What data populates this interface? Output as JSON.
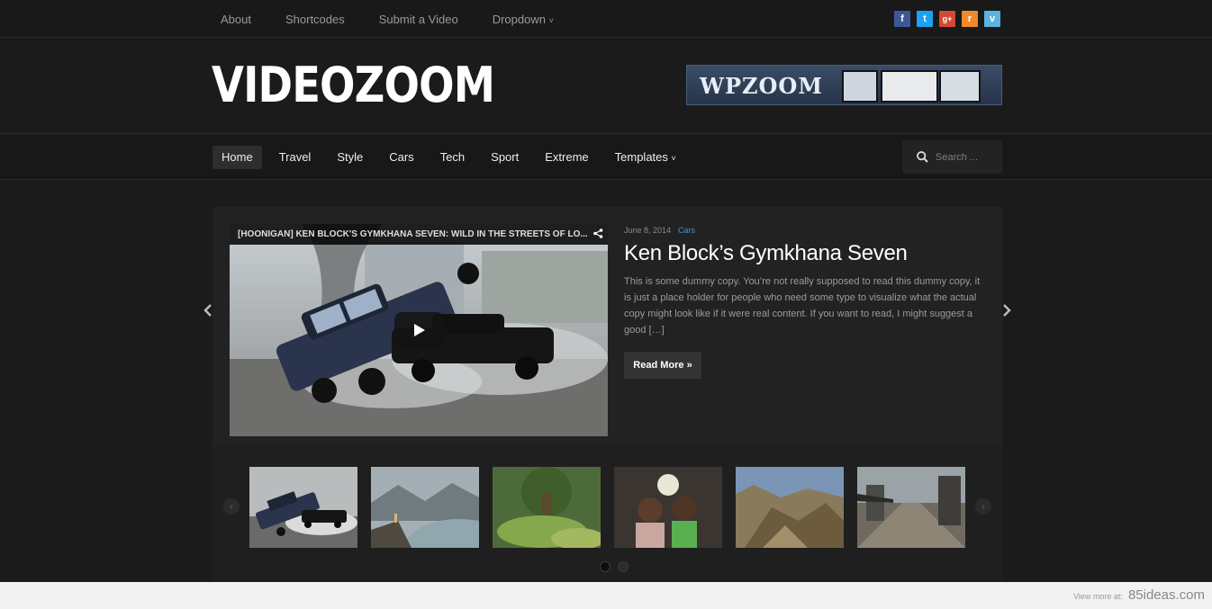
{
  "topnav": {
    "items": [
      {
        "label": "About"
      },
      {
        "label": "Shortcodes"
      },
      {
        "label": "Submit a Video"
      },
      {
        "label": "Dropdown"
      }
    ]
  },
  "social": [
    {
      "icon": "facebook-icon",
      "glyph": "f",
      "color": "#3b5998"
    },
    {
      "icon": "twitter-icon",
      "glyph": "t",
      "color": "#1da1f2"
    },
    {
      "icon": "googleplus-icon",
      "glyph": "g+",
      "color": "#d34836"
    },
    {
      "icon": "rss-icon",
      "glyph": "r",
      "color": "#f0882c"
    },
    {
      "icon": "vimeo-icon",
      "glyph": "v",
      "color": "#5bb3e0"
    }
  ],
  "header": {
    "logo": "VIDEOZOOM",
    "banner_text": "WPZOOM"
  },
  "mainnav": {
    "items": [
      {
        "label": "Home",
        "active": true
      },
      {
        "label": "Travel"
      },
      {
        "label": "Style"
      },
      {
        "label": "Cars"
      },
      {
        "label": "Tech"
      },
      {
        "label": "Sport"
      },
      {
        "label": "Extreme"
      },
      {
        "label": "Templates"
      }
    ],
    "search_placeholder": "Search ..."
  },
  "featured": {
    "video_title": "[HOONIGAN] KEN BLOCK'S GYMKHANA SEVEN: WILD IN THE STREETS OF LO...",
    "date": "June 8, 2014",
    "category": "Cars",
    "title": "Ken Block’s Gymkhana Seven",
    "excerpt": "This is some dummy copy. You’re not really supposed to read this dummy copy, it is just a place holder for people who need some type to visualize what the actual copy might look like if it were real content. If you want to read, I might suggest a good […]",
    "read_more": "Read More »"
  },
  "thumbnails": [
    {
      "name": "cars"
    },
    {
      "name": "mountain-lake"
    },
    {
      "name": "forest-tree"
    },
    {
      "name": "children"
    },
    {
      "name": "canyon"
    },
    {
      "name": "street"
    }
  ],
  "pagination": {
    "pages": 2,
    "active": 0
  },
  "footer": {
    "view_more": "View more at:",
    "site": "85ideas.com"
  },
  "colors": {
    "accent": "#4a8fd6",
    "background": "#1b1b1b"
  }
}
